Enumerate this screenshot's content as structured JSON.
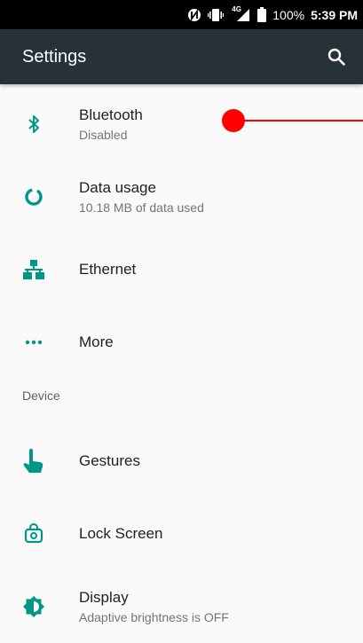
{
  "status_bar": {
    "network": "4G",
    "battery": "100%",
    "time": "5:39 PM",
    "icons": [
      "nfc-icon",
      "vibrate-icon",
      "signal-icon",
      "battery-icon"
    ]
  },
  "app_bar": {
    "title": "Settings",
    "search_icon": "search-icon",
    "color": "#263238"
  },
  "items": [
    {
      "label": "Bluetooth",
      "sub": "Disabled",
      "icon": "bluetooth-icon"
    },
    {
      "label": "Data usage",
      "sub": "10.18 MB of data used",
      "icon": "data-usage-icon"
    },
    {
      "label": "Ethernet",
      "icon": "ethernet-icon"
    },
    {
      "label": "More",
      "icon": "more-icon"
    }
  ],
  "device_section": {
    "header": "Device",
    "items": [
      {
        "label": "Gestures",
        "icon": "gesture-icon"
      },
      {
        "label": "Lock Screen",
        "icon": "lock-screen-icon"
      },
      {
        "label": "Display",
        "sub": "Adaptive brightness is OFF",
        "icon": "display-brightness-icon"
      }
    ]
  },
  "accent_color": "#009688",
  "marker_color": "#ff0000"
}
